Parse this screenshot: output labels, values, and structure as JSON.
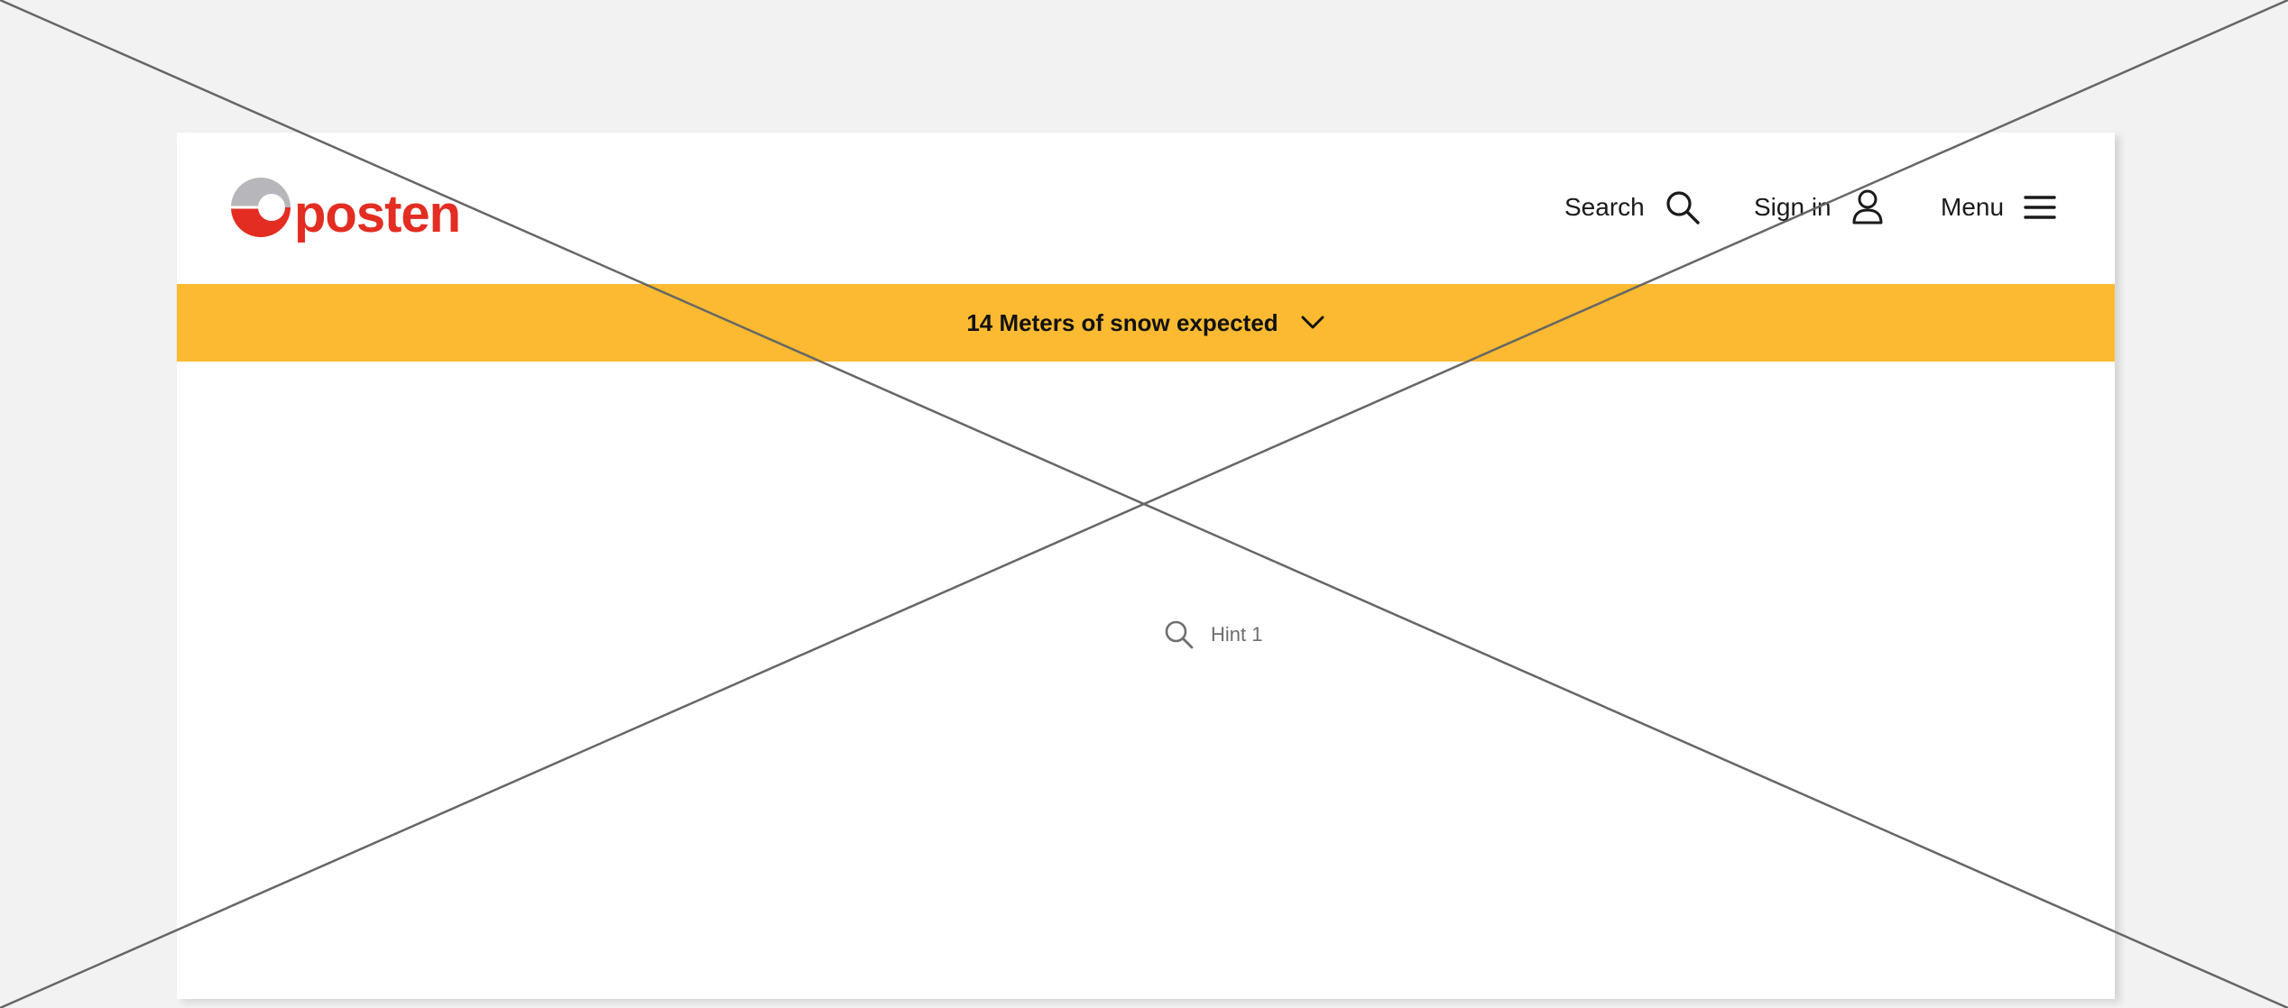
{
  "logo": {
    "text": "posten",
    "brand_red": "#e32d22",
    "brand_grey": "#b7b7bb"
  },
  "header": {
    "search_label": "Search",
    "signin_label": "Sign in",
    "menu_label": "Menu",
    "search_icon": "search-icon",
    "user_icon": "user-icon",
    "menu_icon": "hamburger-icon"
  },
  "banner": {
    "text": "14 Meters of snow expected",
    "icon": "chevron-down-icon",
    "color": "#fbba31"
  },
  "placeholder": {
    "hint_text": "Hint 1",
    "icon": "search-icon",
    "line_color": "#666666"
  }
}
